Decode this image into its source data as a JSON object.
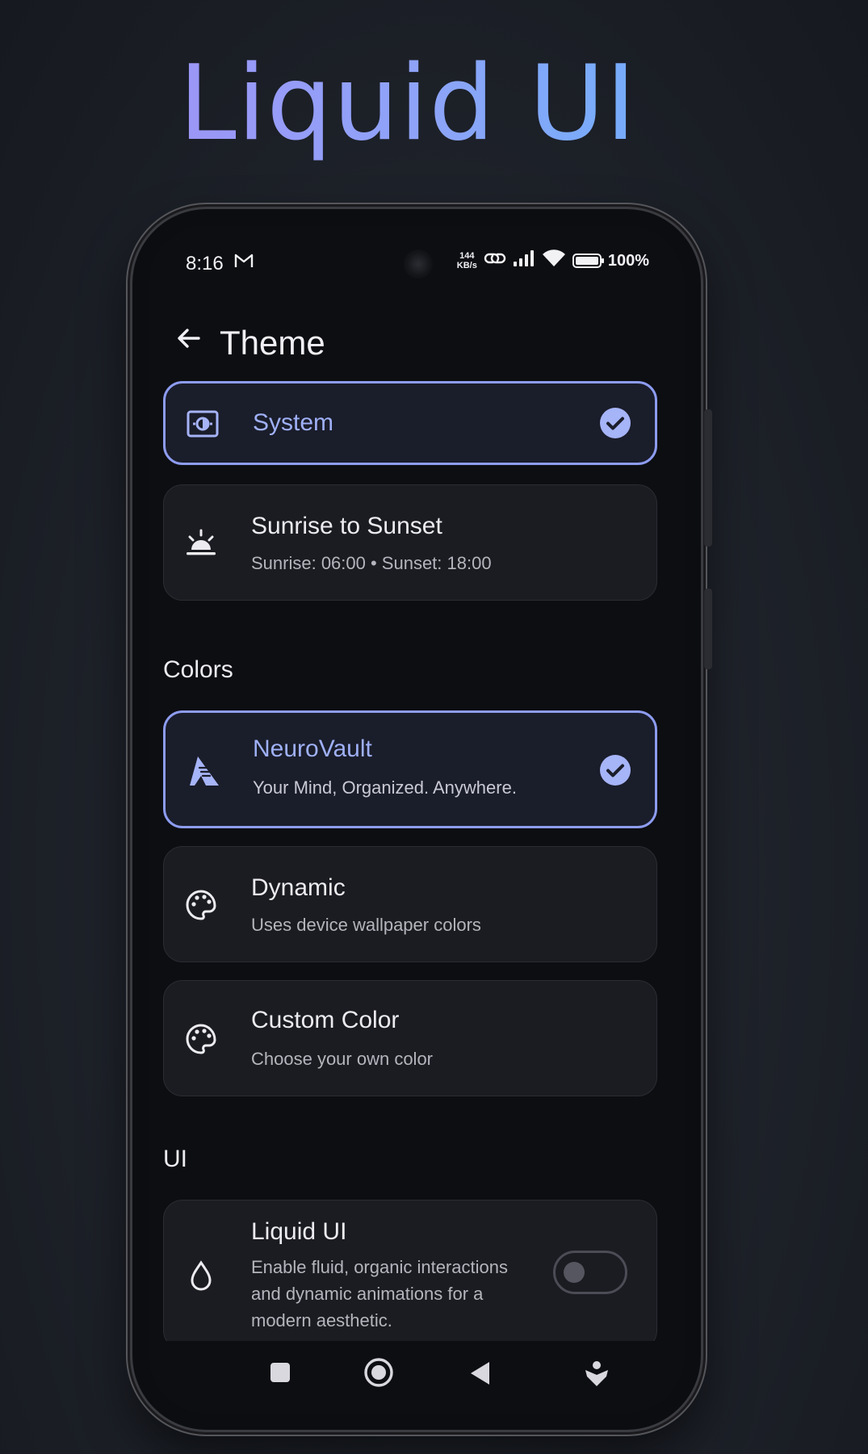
{
  "hero": {
    "title": "Liquid UI"
  },
  "status_bar": {
    "time": "8:16",
    "speed_value": "144",
    "speed_unit": "KB/s",
    "battery": "100%",
    "battery_level": 1.0
  },
  "app_bar": {
    "title": "Theme"
  },
  "theme_options": [
    {
      "title": "System",
      "selected": true
    },
    {
      "title": "Sunrise to Sunset",
      "subtitle": "Sunrise: 06:00 • Sunset: 18:00",
      "selected": false
    }
  ],
  "colors_section": {
    "heading": "Colors",
    "options": [
      {
        "title": "NeuroVault",
        "subtitle": "Your Mind, Organized. Anywhere.",
        "selected": true
      },
      {
        "title": "Dynamic",
        "subtitle": "Uses device wallpaper colors",
        "selected": false
      },
      {
        "title": "Custom Color",
        "subtitle": "Choose your own color",
        "selected": false
      }
    ]
  },
  "ui_section": {
    "heading": "UI",
    "liquid_ui": {
      "title": "Liquid UI",
      "subtitle_lines": [
        "Enable fluid, organic interactions",
        "and dynamic animations for a",
        "modern aesthetic."
      ],
      "enabled": false
    }
  },
  "colors": {
    "accent": "#8d9cf0",
    "check": "#a6b4f8",
    "card_bg": "#1b1c21",
    "screen_bg": "#0d0e12"
  },
  "icons": {
    "back": "arrow-left-icon",
    "system": "brightness-auto-icon",
    "sunrise": "sunrise-icon",
    "neurovault": "neurovault-logo-icon",
    "dynamic": "palette-icon",
    "custom": "palette-icon",
    "liquid": "water-drop-icon",
    "selected": "check-circle-icon"
  }
}
